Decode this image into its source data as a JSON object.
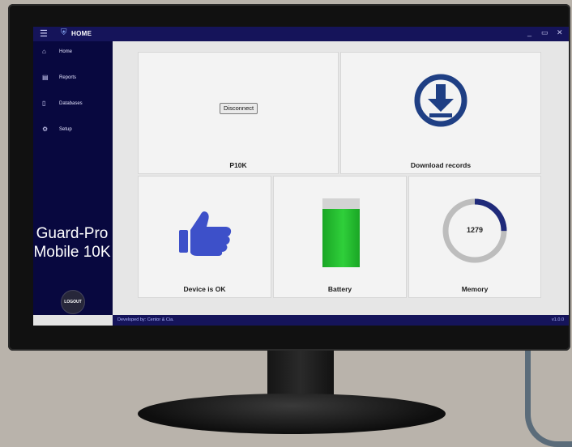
{
  "window": {
    "title": "HOME"
  },
  "sidebar": {
    "items": [
      {
        "label": "Home",
        "icon": "home-icon"
      },
      {
        "label": "Reports",
        "icon": "report-icon"
      },
      {
        "label": "Databases",
        "icon": "database-icon"
      },
      {
        "label": "Setup",
        "icon": "gear-icon"
      }
    ],
    "logout_label": "LOGOUT"
  },
  "overlay": {
    "line1": "Guard-Pro",
    "line2": "Mobile 10K"
  },
  "tiles": {
    "device": {
      "label": "P10K",
      "button_label": "Disconnect"
    },
    "download": {
      "label": "Download records",
      "icon": "download-icon"
    },
    "status": {
      "label": "Device is OK",
      "icon": "thumbs-up-icon"
    },
    "battery": {
      "label": "Battery",
      "level": 0.85
    },
    "memory": {
      "label": "Memory",
      "value": "1279",
      "fraction": 0.25
    }
  },
  "footer": {
    "developer": "Developed by: Centor & Cia.",
    "version": "v1.0.0"
  },
  "colors": {
    "titlebar": "#15145a",
    "sidebar": "#08083f",
    "accent_blue": "#1f3f84",
    "thumb_blue": "#3d50c9",
    "battery_green": "#22bb2e",
    "memory_ring": "#bdbdbd"
  }
}
